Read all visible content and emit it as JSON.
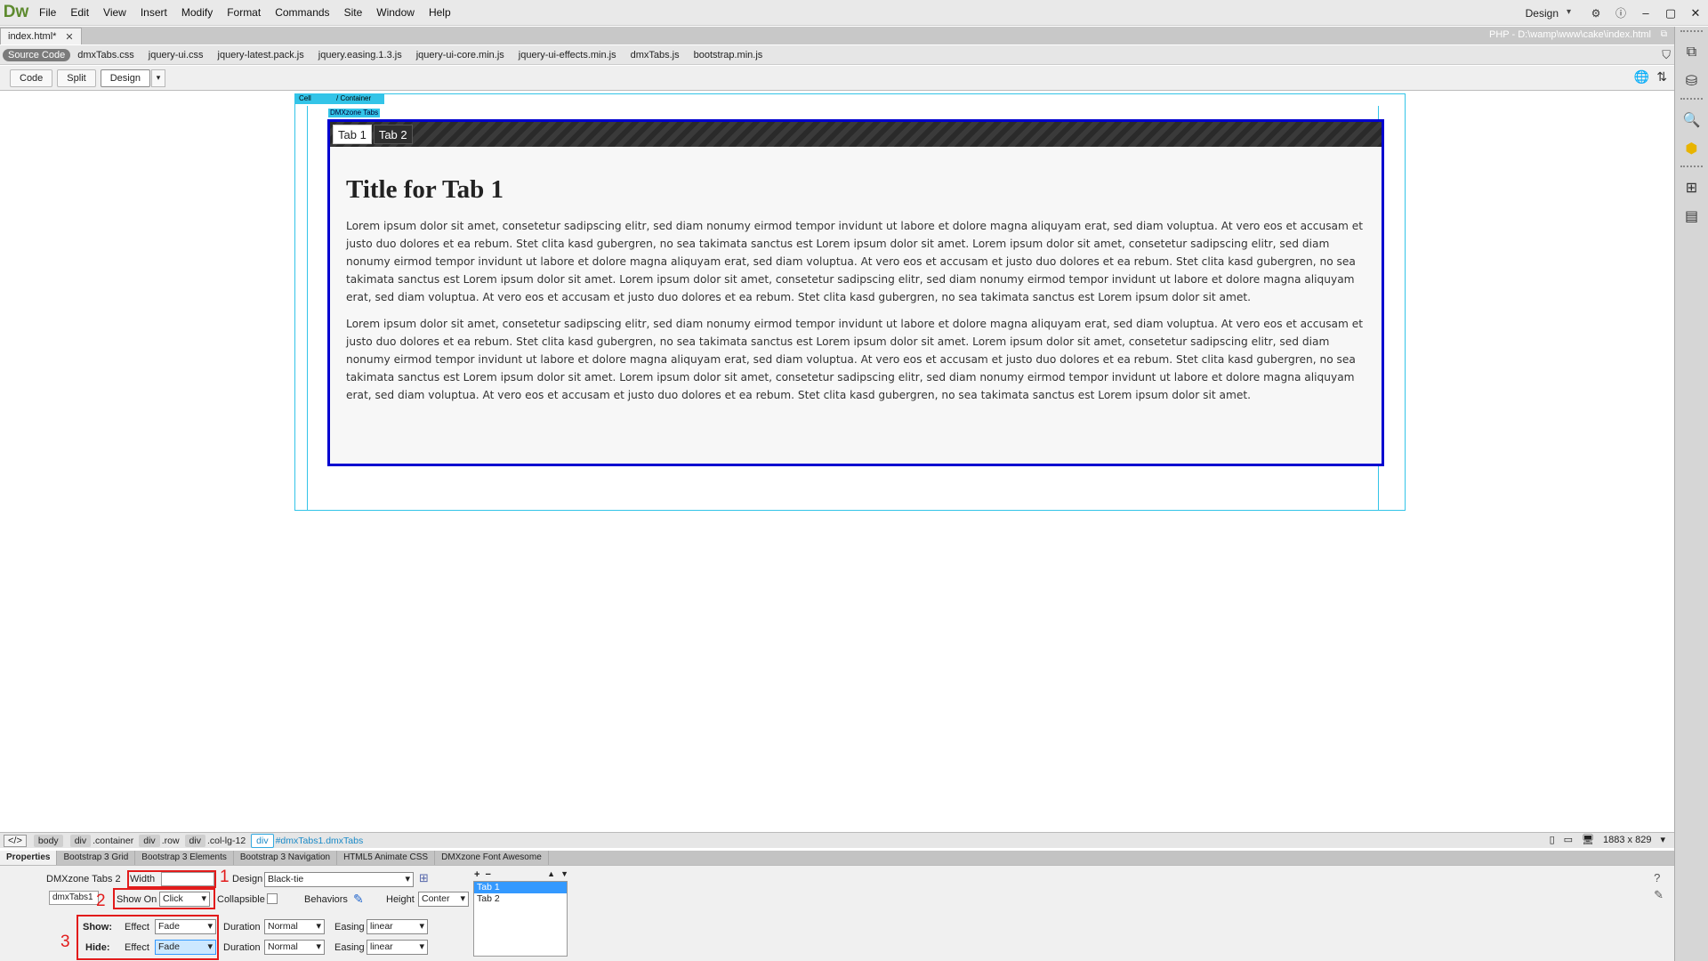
{
  "app": {
    "logo": "Dw",
    "menu": [
      "File",
      "Edit",
      "View",
      "Insert",
      "Modify",
      "Format",
      "Commands",
      "Site",
      "Window",
      "Help"
    ],
    "workspace": "Design"
  },
  "document": {
    "tab_name": "index.html*",
    "path": "PHP - D:\\wamp\\www\\cake\\index.html",
    "related_files": [
      "Source Code",
      "dmxTabs.css",
      "jquery-ui.css",
      "jquery-latest.pack.js",
      "jquery.easing.1.3.js",
      "jquery-ui-core.min.js",
      "jquery-ui-effects.min.js",
      "dmxTabs.js",
      "bootstrap.min.js"
    ]
  },
  "views": {
    "code": "Code",
    "split": "Split",
    "design": "Design"
  },
  "canvas": {
    "cell_label": "Cell",
    "container_label": "/ Container",
    "tabs_label": "DMXzone Tabs",
    "tabs": [
      "Tab 1",
      "Tab 2"
    ],
    "title": "Title for Tab 1",
    "para1": "Lorem ipsum dolor sit amet, consetetur sadipscing elitr, sed diam nonumy eirmod tempor invidunt ut labore et dolore magna aliquyam erat, sed diam voluptua. At vero eos et accusam et justo duo dolores et ea rebum. Stet clita kasd gubergren, no sea takimata sanctus est Lorem ipsum dolor sit amet. Lorem ipsum dolor sit amet, consetetur sadipscing elitr, sed diam nonumy eirmod tempor invidunt ut labore et dolore magna aliquyam erat, sed diam voluptua. At vero eos et accusam et justo duo dolores et ea rebum. Stet clita kasd gubergren, no sea takimata sanctus est Lorem ipsum dolor sit amet. Lorem ipsum dolor sit amet, consetetur sadipscing elitr, sed diam nonumy eirmod tempor invidunt ut labore et dolore magna aliquyam erat, sed diam voluptua. At vero eos et accusam et justo duo dolores et ea rebum. Stet clita kasd gubergren, no sea takimata sanctus est Lorem ipsum dolor sit amet.",
    "para2": "Lorem ipsum dolor sit amet, consetetur sadipscing elitr, sed diam nonumy eirmod tempor invidunt ut labore et dolore magna aliquyam erat, sed diam voluptua. At vero eos et accusam et justo duo dolores et ea rebum. Stet clita kasd gubergren, no sea takimata sanctus est Lorem ipsum dolor sit amet. Lorem ipsum dolor sit amet, consetetur sadipscing elitr, sed diam nonumy eirmod tempor invidunt ut labore et dolore magna aliquyam erat, sed diam voluptua. At vero eos et accusam et justo duo dolores et ea rebum. Stet clita kasd gubergren, no sea takimata sanctus est Lorem ipsum dolor sit amet. Lorem ipsum dolor sit amet, consetetur sadipscing elitr, sed diam nonumy eirmod tempor invidunt ut labore et dolore magna aliquyam erat, sed diam voluptua. At vero eos et accusam et justo duo dolores et ea rebum. Stet clita kasd gubergren, no sea takimata sanctus est Lorem ipsum dolor sit amet."
  },
  "tagbar": {
    "code_tag": "</>",
    "crumbs": [
      {
        "tag": "body",
        "cls": ""
      },
      {
        "tag": "div",
        "cls": ".container"
      },
      {
        "tag": "div",
        "cls": ".row"
      },
      {
        "tag": "div",
        "cls": ".col-lg-12"
      },
      {
        "tag": "div",
        "cls": "#dmxTabs1.dmxTabs"
      }
    ],
    "size": "1883 x 829"
  },
  "panels": [
    "Properties",
    "Bootstrap 3 Grid",
    "Bootstrap 3 Elements",
    "Bootstrap 3 Navigation",
    "HTML5 Animate CSS",
    "DMXzone Font Awesome"
  ],
  "inspector": {
    "component": "DMXzone Tabs 2",
    "id_value": "dmxTabs1",
    "width_label": "Width",
    "width_value": "",
    "design_label": "Design",
    "design_value": "Black-tie",
    "show_on_label": "Show On",
    "show_on_value": "Click",
    "collapsible_label": "Collapsible",
    "behaviors_label": "Behaviors",
    "height_label": "Height",
    "height_value": "Conter",
    "show_label": "Show:",
    "hide_label": "Hide:",
    "effect_label": "Effect",
    "show_effect": "Fade",
    "hide_effect": "Fade",
    "duration_label": "Duration",
    "show_duration": "Normal",
    "hide_duration": "Normal",
    "easing_label": "Easing",
    "show_easing": "linear",
    "hide_easing": "linear",
    "tab_list": [
      "Tab 1",
      "Tab 2"
    ],
    "annotations": [
      "1",
      "2",
      "3"
    ]
  },
  "colors": {
    "guide": "#33c4e8",
    "selection": "#0000d0",
    "annotation": "#e21b1b",
    "logo": "#5d8a2e"
  }
}
